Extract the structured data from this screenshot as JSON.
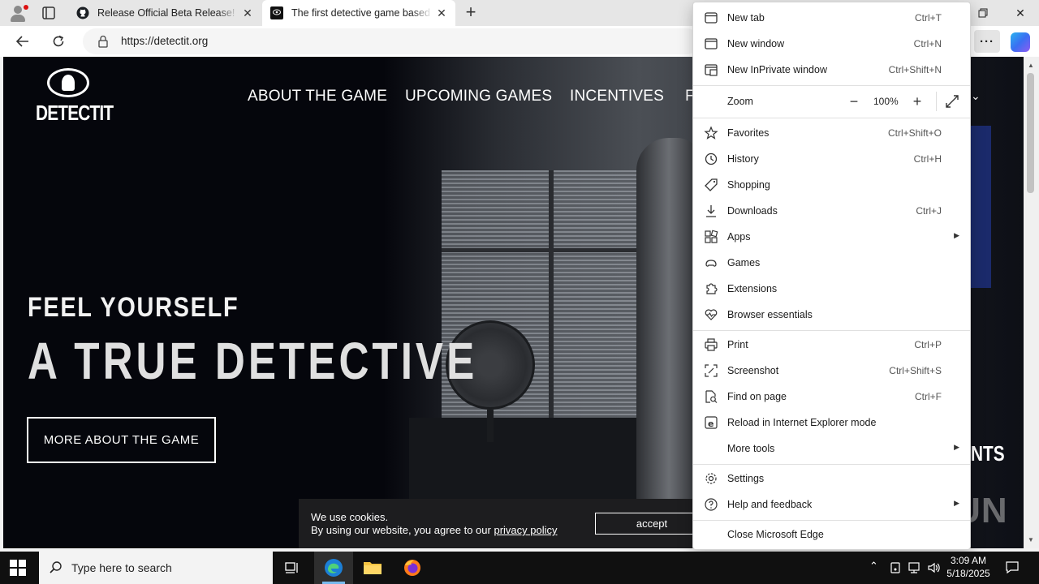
{
  "browser": {
    "tabs": [
      {
        "title": "Release Official Beta Release! · Bli",
        "favicon": "github-icon",
        "active": false
      },
      {
        "title": "The first detective game based on",
        "favicon": "detectit-icon",
        "active": true
      }
    ],
    "url": "https://detectit.org",
    "more_label": "···"
  },
  "site": {
    "logo_text": "DETECTIT",
    "nav": [
      "ABOUT THE GAME",
      "UPCOMING GAMES",
      "INCENTIVES",
      "F"
    ],
    "hero_line1": "FEEL YOURSELF",
    "hero_line2": "A TRUE DETECTIVE",
    "cta": "MORE ABOUT THE GAME",
    "side_text": "NTS",
    "cookie": {
      "line1": "We use cookies.",
      "line2_prefix": "By using our website, you agree to our ",
      "link": "privacy policy",
      "accept": "accept"
    }
  },
  "menu": {
    "items": [
      {
        "label": "New tab",
        "shortcut": "Ctrl+T",
        "icon": "new-tab-icon"
      },
      {
        "label": "New window",
        "shortcut": "Ctrl+N",
        "icon": "new-window-icon"
      },
      {
        "label": "New InPrivate window",
        "shortcut": "Ctrl+Shift+N",
        "icon": "inprivate-icon"
      },
      {
        "label": "Zoom",
        "icon": ""
      },
      {
        "label": "Favorites",
        "shortcut": "Ctrl+Shift+O",
        "icon": "favorites-icon"
      },
      {
        "label": "History",
        "shortcut": "Ctrl+H",
        "icon": "history-icon"
      },
      {
        "label": "Shopping",
        "shortcut": "",
        "icon": "shopping-tag-icon"
      },
      {
        "label": "Downloads",
        "shortcut": "Ctrl+J",
        "icon": "download-icon"
      },
      {
        "label": "Apps",
        "shortcut": "",
        "icon": "apps-icon"
      },
      {
        "label": "Games",
        "shortcut": "",
        "icon": "games-icon"
      },
      {
        "label": "Extensions",
        "shortcut": "",
        "icon": "extensions-icon"
      },
      {
        "label": "Browser essentials",
        "shortcut": "",
        "icon": "heart-pulse-icon"
      },
      {
        "label": "Print",
        "shortcut": "Ctrl+P",
        "icon": "print-icon"
      },
      {
        "label": "Screenshot",
        "shortcut": "Ctrl+Shift+S",
        "icon": "screenshot-icon"
      },
      {
        "label": "Find on page",
        "shortcut": "Ctrl+F",
        "icon": "find-icon"
      },
      {
        "label": "Reload in Internet Explorer mode",
        "shortcut": "",
        "icon": "ie-icon"
      },
      {
        "label": "More tools",
        "shortcut": "",
        "icon": ""
      },
      {
        "label": "Settings",
        "shortcut": "",
        "icon": "gear-icon"
      },
      {
        "label": "Help and feedback",
        "shortcut": "",
        "icon": "help-icon"
      },
      {
        "label": "Close Microsoft Edge",
        "shortcut": "",
        "icon": ""
      }
    ],
    "zoom_value": "100%"
  },
  "watermark": "ANY RUN",
  "taskbar": {
    "search_placeholder": "Type here to search",
    "time": "3:09 AM",
    "date": "5/18/2025"
  }
}
